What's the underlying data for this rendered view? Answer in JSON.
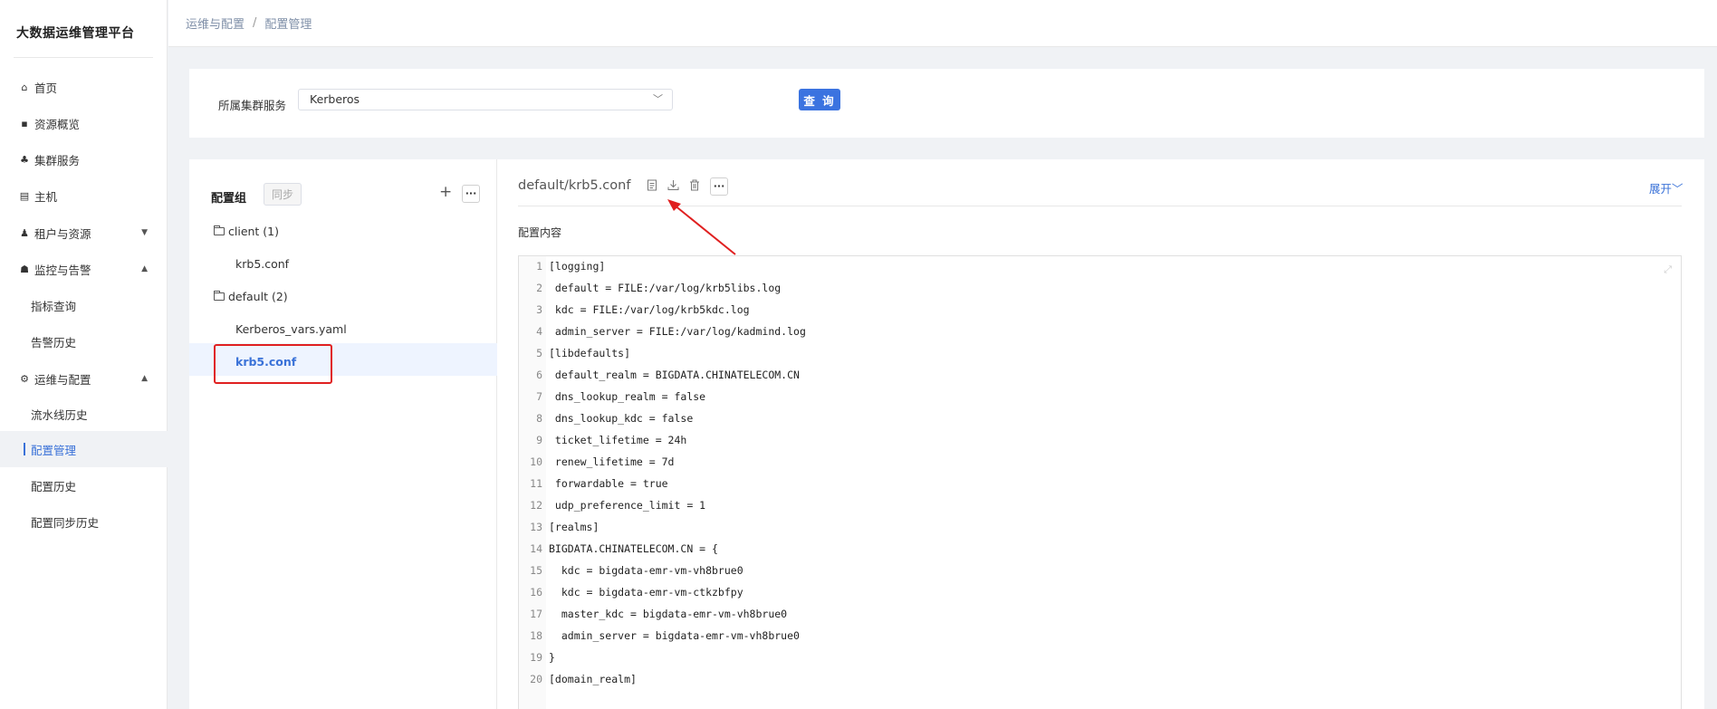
{
  "sidebar": {
    "brand": "大数据运维管理平台",
    "items": [
      {
        "label": "首页",
        "icon": "home-icon",
        "glyph": "⌂"
      },
      {
        "label": "资源概览",
        "icon": "monitor-icon",
        "glyph": "▪"
      },
      {
        "label": "集群服务",
        "icon": "cluster-icon",
        "glyph": "♣"
      },
      {
        "label": "主机",
        "icon": "server-icon",
        "glyph": "▤"
      },
      {
        "label": "租户与资源",
        "icon": "user-icon",
        "glyph": "♟",
        "caret": "▼"
      },
      {
        "label": "监控与告警",
        "icon": "bell-icon",
        "glyph": "☗",
        "caret": "▲"
      },
      {
        "label": "指标查询"
      },
      {
        "label": "告警历史"
      },
      {
        "label": "运维与配置",
        "icon": "gear-icon",
        "glyph": "⚙",
        "caret": "▲"
      },
      {
        "label": "流水线历史"
      },
      {
        "label": "配置管理"
      },
      {
        "label": "配置历史"
      },
      {
        "label": "配置同步历史"
      }
    ]
  },
  "breadcrumb": {
    "parent": "运维与配置",
    "separator": "/",
    "current": "配置管理"
  },
  "filter": {
    "label": "所属集群服务",
    "selected": "Kerberos",
    "query_button": "查 询"
  },
  "config_group": {
    "title": "配置组",
    "sync_button": "同步",
    "add_glyph": "+",
    "more_glyph": "···",
    "folders": [
      {
        "name": "client (1)",
        "files": [
          "krb5.conf"
        ]
      },
      {
        "name": "default (2)",
        "files": [
          "Kerberos_vars.yaml",
          "krb5.conf"
        ]
      }
    ]
  },
  "file_view": {
    "title": "default/krb5.conf",
    "expand_link": "展开",
    "content_label": "配置内容",
    "more_glyph": "···",
    "lines": [
      "[logging]",
      " default = FILE:/var/log/krb5libs.log",
      " kdc = FILE:/var/log/krb5kdc.log",
      " admin_server = FILE:/var/log/kadmind.log",
      "[libdefaults]",
      " default_realm = BIGDATA.CHINATELECOM.CN",
      " dns_lookup_realm = false",
      " dns_lookup_kdc = false",
      " ticket_lifetime = 24h",
      " renew_lifetime = 7d",
      " forwardable = true",
      " udp_preference_limit = 1",
      "[realms]",
      "BIGDATA.CHINATELECOM.CN = {",
      "  kdc = bigdata-emr-vm-vh8brue0",
      "  kdc = bigdata-emr-vm-ctkzbfpy",
      "  master_kdc = bigdata-emr-vm-vh8brue0",
      "  admin_server = bigdata-emr-vm-vh8brue0",
      "}",
      "[domain_realm]"
    ],
    "line_numbers": [
      "1",
      "2",
      "3",
      "4",
      "5",
      "6",
      "7",
      "8",
      "9",
      "10",
      "11",
      "12",
      "13",
      "14",
      "15",
      "16",
      "17",
      "18",
      "19",
      "20"
    ]
  },
  "colors": {
    "accent": "#3a72d8",
    "annotation_red": "#e02020"
  }
}
